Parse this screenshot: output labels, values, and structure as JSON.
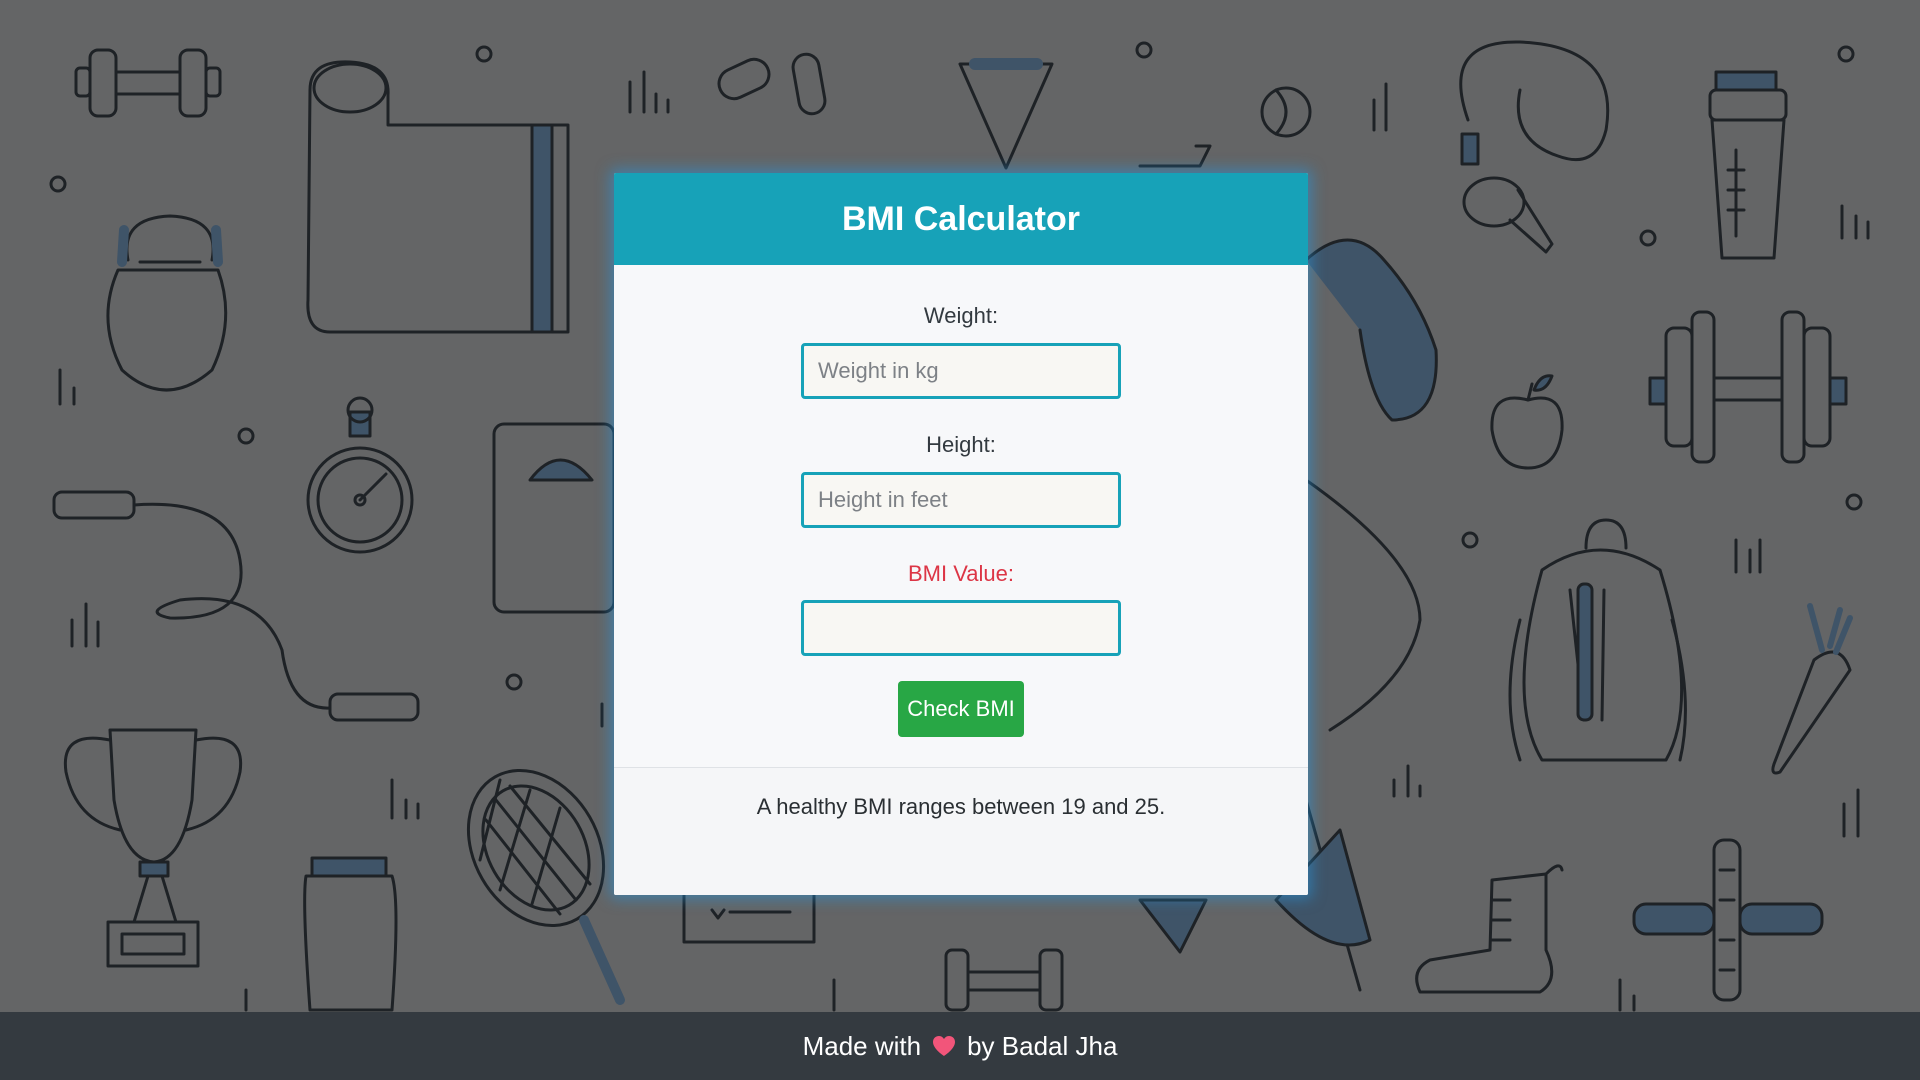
{
  "card": {
    "title": "BMI Calculator",
    "weight": {
      "label": "Weight:",
      "placeholder": "Weight in kg",
      "value": ""
    },
    "height": {
      "label": "Height:",
      "placeholder": "Height in feet",
      "value": ""
    },
    "bmi": {
      "label": "BMI Value:",
      "value": ""
    },
    "button_label": "Check BMI",
    "footer_note": "A healthy BMI ranges between 19 and 25."
  },
  "page_footer": {
    "prefix": "Made with",
    "icon": "heart-icon",
    "suffix": "by Badal Jha"
  },
  "colors": {
    "header": "#17a2b8",
    "button": "#28a745",
    "bmi_label": "#dc3545",
    "footer": "#343a40"
  }
}
